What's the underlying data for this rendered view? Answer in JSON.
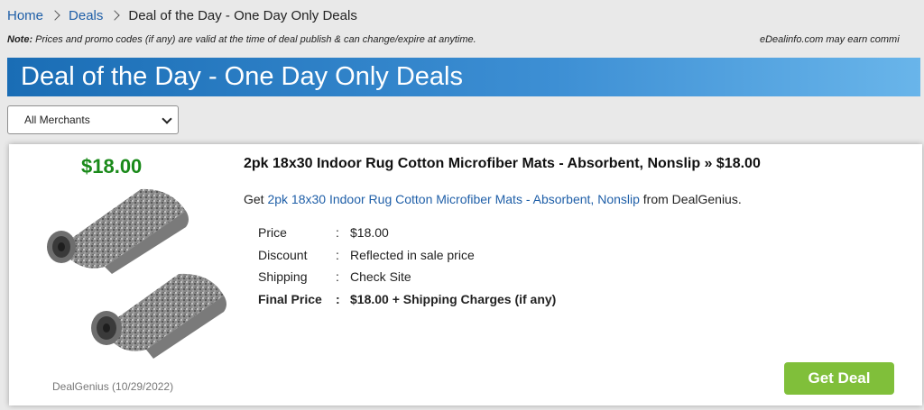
{
  "breadcrumb": {
    "home": "Home",
    "deals": "Deals",
    "current": "Deal of the Day - One Day Only Deals"
  },
  "note": {
    "label": "Note:",
    "text": " Prices and promo codes (if any) are valid at the time of deal publish & can change/expire at anytime.",
    "disclosure": "eDealinfo.com may earn commi"
  },
  "banner": {
    "title": "Deal of the Day - One Day Only Deals"
  },
  "merchant_filter": {
    "selected": "All Merchants"
  },
  "deal": {
    "price_big": "$18.00",
    "title": "2pk 18x30 Indoor Rug Cotton Microfiber Mats - Absorbent, Nonslip » $18.00",
    "desc_prefix": "Get ",
    "desc_link": "2pk 18x30 Indoor Rug Cotton Microfiber Mats - Absorbent, Nonslip",
    "desc_suffix": " from DealGenius.",
    "details": {
      "colon": ":",
      "price_label": "Price",
      "price_value": "$18.00",
      "discount_label": "Discount",
      "discount_value": "Reflected in sale price",
      "shipping_label": "Shipping",
      "shipping_value": "Check Site",
      "final_label": "Final Price",
      "final_value": "$18.00 + Shipping Charges (if any)"
    },
    "store_date": "DealGenius (10/29/2022)",
    "button": "Get Deal"
  },
  "colors": {
    "link": "#1f5fa8",
    "price_green": "#1a8a1a",
    "button_green": "#80bf3a",
    "banner_blue": "#1a6db5"
  }
}
